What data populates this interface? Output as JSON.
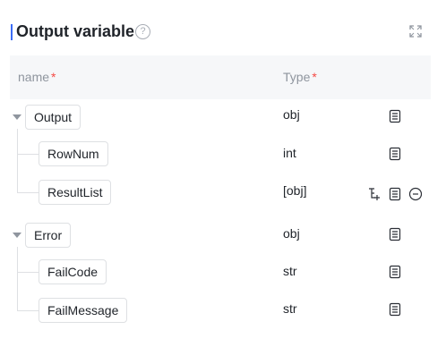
{
  "panel": {
    "title": "Output variable",
    "help_icon": "help-circle-icon",
    "expand_icon": "fullscreen-expand-icon"
  },
  "table": {
    "columns": {
      "name": "name",
      "type": "Type",
      "required_mark": "*"
    },
    "rows": [
      {
        "name": "Output",
        "type": "obj",
        "level": 0,
        "expanded": true
      },
      {
        "name": "RowNum",
        "type": "int",
        "level": 1
      },
      {
        "name": "ResultList",
        "type": "[obj]",
        "level": 1,
        "extra_actions": [
          "add-child-icon",
          "remove-circle-icon"
        ]
      },
      {
        "name": "Error",
        "type": "obj",
        "level": 0,
        "expanded": true
      },
      {
        "name": "FailCode",
        "type": "str",
        "level": 1
      },
      {
        "name": "FailMessage",
        "type": "str",
        "level": 1
      }
    ],
    "row_action_icon": "document-list-icon"
  },
  "colors": {
    "accent": "#3b6cf5",
    "required": "#f54a45",
    "header_bg": "#f6f7f9",
    "border": "#dee0e3"
  }
}
